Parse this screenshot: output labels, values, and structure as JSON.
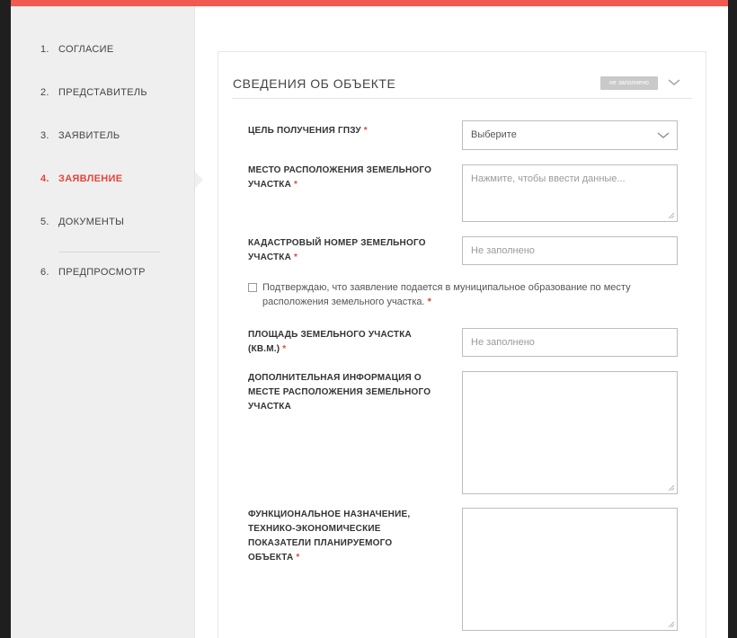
{
  "steps": [
    {
      "num": "1.",
      "label": "СОГЛАСИЕ"
    },
    {
      "num": "2.",
      "label": "ПРЕДСТАВИТЕЛЬ"
    },
    {
      "num": "3.",
      "label": "ЗАЯВИТЕЛЬ"
    },
    {
      "num": "4.",
      "label": "ЗАЯВЛЕНИЕ",
      "active": true
    },
    {
      "num": "5.",
      "label": "ДОКУМЕНТЫ"
    },
    {
      "num": "6.",
      "label": "ПРЕДПРОСМОТР"
    }
  ],
  "panel": {
    "title": "СВЕДЕНИЯ ОБ ОБЪЕКТЕ",
    "badge": "не заполнено"
  },
  "form": {
    "required_mark": "*",
    "purpose": {
      "label": "ЦЕЛЬ ПОЛУЧЕНИЯ ГПЗУ",
      "value": "Выберите"
    },
    "location": {
      "label": "МЕСТО РАСПОЛОЖЕНИЯ ЗЕМЕЛЬНОГО УЧАСТКА",
      "placeholder": "Нажмите, чтобы ввести данные..."
    },
    "cadastral": {
      "label": "КАДАСТРОВЫЙ НОМЕР ЗЕМЕЛЬНОГО УЧАСТКА",
      "placeholder": "Не заполнено"
    },
    "confirm": {
      "text": "Подтверждаю, что заявление подается в муниципальное образование по месту расположения земельного участка."
    },
    "area": {
      "label": "ПЛОЩАДЬ ЗЕМЕЛЬНОГО УЧАСТКА (КВ.М.)",
      "placeholder": "Не заполнено"
    },
    "additional": {
      "label": "ДОПОЛНИТЕЛЬНАЯ ИНФОРМАЦИЯ О МЕСТЕ РАСПОЛОЖЕНИЯ ЗЕМЕЛЬНОГО УЧАСТКА",
      "placeholder": ""
    },
    "functional": {
      "label": "ФУНКЦИОНАЛЬНОЕ НАЗНАЧЕНИЕ, ТЕХНИКО-ЭКОНОМИЧЕСКИЕ ПОКАЗАТЕЛИ ПЛАНИРУЕМОГО ОБЪЕКТА",
      "placeholder": ""
    }
  },
  "colors": {
    "accent": "#f15a50",
    "active_step": "#e2463f",
    "sidebar_bg": "#efefef"
  },
  "icons": {
    "panel_toggle": "chevron-down-icon",
    "select_toggle": "chevron-down-icon",
    "resize": "resize-grip-icon"
  }
}
